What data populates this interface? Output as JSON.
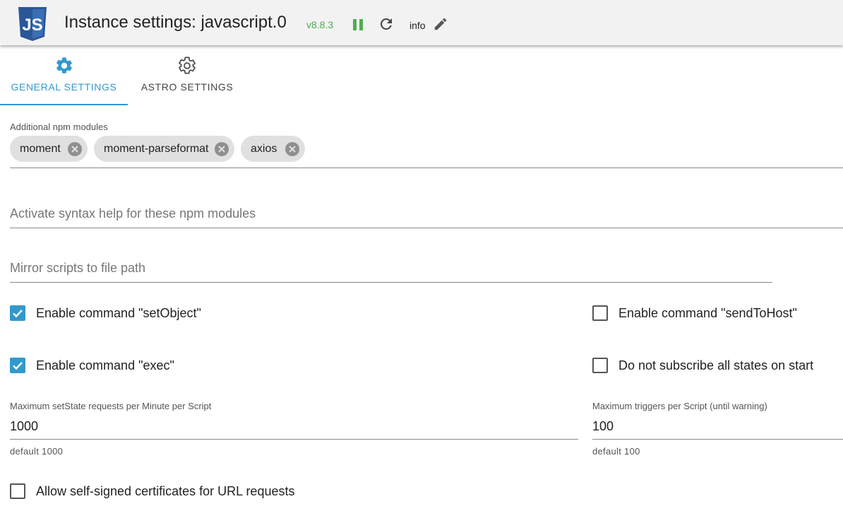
{
  "header": {
    "title": "Instance settings: javascript.0",
    "version": "v8.8.3",
    "log_level": "info",
    "logo_text": "JS",
    "colors": {
      "logo": "#2b5797",
      "version": "#4caf50",
      "accent": "#3399cc"
    }
  },
  "tabs": [
    {
      "label": "GENERAL SETTINGS",
      "icon": "gear-icon",
      "active": true
    },
    {
      "label": "ASTRO SETTINGS",
      "icon": "gear-outline-icon",
      "active": false
    }
  ],
  "form": {
    "npm_modules": {
      "label": "Additional npm modules",
      "chips": [
        "moment",
        "moment-parseformat",
        "axios"
      ]
    },
    "syntax_help": {
      "placeholder": "Activate syntax help for these npm modules",
      "value": ""
    },
    "mirror_path": {
      "placeholder": "Mirror scripts to file path",
      "value": ""
    },
    "checkboxes": {
      "set_object": {
        "label": "Enable command \"setObject\"",
        "checked": true
      },
      "send_to_host": {
        "label": "Enable command \"sendToHost\"",
        "checked": false
      },
      "exec": {
        "label": "Enable command \"exec\"",
        "checked": true
      },
      "no_subscribe": {
        "label": "Do not subscribe all states on start",
        "checked": false
      },
      "self_signed": {
        "label": "Allow self-signed certificates for URL requests",
        "checked": false
      }
    },
    "max_set_state": {
      "label": "Maximum setState requests per Minute per Script",
      "value": "1000",
      "helper": "default 1000"
    },
    "max_triggers": {
      "label": "Maximum triggers per Script (until warning)",
      "value": "100",
      "helper": "default 100"
    }
  }
}
